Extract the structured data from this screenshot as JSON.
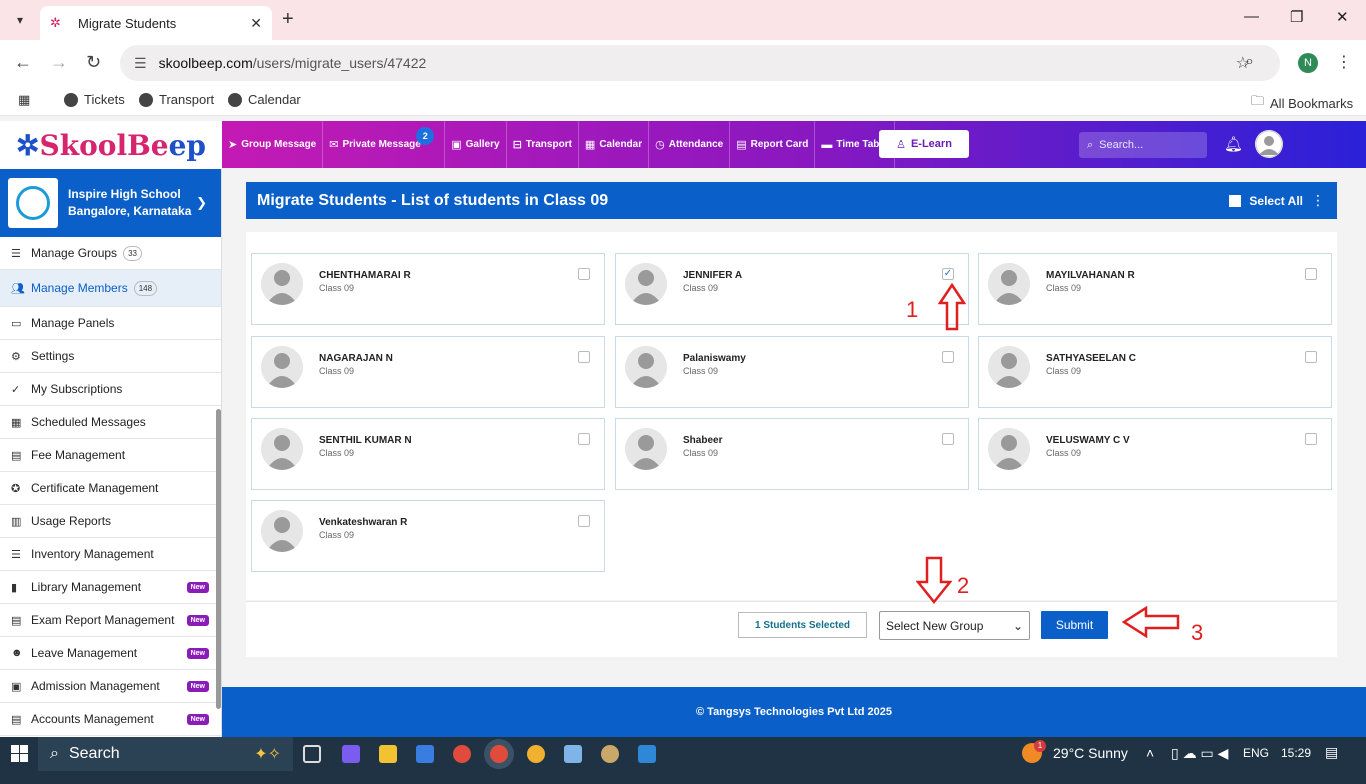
{
  "browser": {
    "tab_title": "Migrate Students",
    "url_host": "skoolbeep.com",
    "url_path": "/users/migrate_users/47422",
    "bookmarks": [
      "Tickets",
      "Transport",
      "Calendar"
    ],
    "all_bookmarks": "All Bookmarks",
    "profile_initial": "N"
  },
  "app": {
    "logo_a": "SkoolBe",
    "logo_b": "ep",
    "nav": [
      {
        "label": "Group Message",
        "icon": "send-icon"
      },
      {
        "label": "Private Message",
        "icon": "mail-icon",
        "badge": "2"
      },
      {
        "label": "Gallery",
        "icon": "image-icon"
      },
      {
        "label": "Transport",
        "icon": "bus-icon"
      },
      {
        "label": "Calendar",
        "icon": "calendar-icon"
      },
      {
        "label": "Attendance",
        "icon": "clock-icon"
      },
      {
        "label": "Report Card",
        "icon": "document-icon"
      },
      {
        "label": "Time Table",
        "icon": "timetable-icon"
      }
    ],
    "elearn": "E-Learn",
    "search_placeholder": "Search..."
  },
  "sidebar": {
    "school_name": "Inspire High School",
    "school_location": "Bangalore, Karnataka",
    "items": [
      {
        "label": "Manage Groups",
        "count": "33",
        "new": ""
      },
      {
        "label": "Manage Members",
        "count": "148",
        "new": ""
      },
      {
        "label": "Manage Panels",
        "count": "",
        "new": ""
      },
      {
        "label": "Settings",
        "count": "",
        "new": ""
      },
      {
        "label": "My Subscriptions",
        "count": "",
        "new": ""
      },
      {
        "label": "Scheduled Messages",
        "count": "",
        "new": ""
      },
      {
        "label": "Fee Management",
        "count": "",
        "new": ""
      },
      {
        "label": "Certificate Management",
        "count": "",
        "new": ""
      },
      {
        "label": "Usage Reports",
        "count": "",
        "new": ""
      },
      {
        "label": "Inventory Management",
        "count": "",
        "new": ""
      },
      {
        "label": "Library Management",
        "count": "",
        "new": "New"
      },
      {
        "label": "Exam Report Management",
        "count": "",
        "new": "New"
      },
      {
        "label": "Leave Management",
        "count": "",
        "new": "New"
      },
      {
        "label": "Admission Management",
        "count": "",
        "new": "New"
      },
      {
        "label": "Accounts Management",
        "count": "",
        "new": "New"
      }
    ]
  },
  "main": {
    "title": "Migrate Students - List of students in Class 09",
    "select_all": "Select All",
    "students": [
      {
        "name": "CHENTHAMARAI R",
        "class": "Class 09",
        "checked": false
      },
      {
        "name": "JENNIFER A",
        "class": "Class 09",
        "checked": true
      },
      {
        "name": "MAYILVAHANAN R",
        "class": "Class 09",
        "checked": false
      },
      {
        "name": "NAGARAJAN N",
        "class": "Class 09",
        "checked": false
      },
      {
        "name": "Palaniswamy",
        "class": "Class 09",
        "checked": false
      },
      {
        "name": "SATHYASEELAN C",
        "class": "Class 09",
        "checked": false
      },
      {
        "name": "SENTHIL KUMAR N",
        "class": "Class 09",
        "checked": false
      },
      {
        "name": "Shabeer",
        "class": "Class 09",
        "checked": false
      },
      {
        "name": "VELUSWAMY C V",
        "class": "Class 09",
        "checked": false
      },
      {
        "name": "Venkateshwaran R",
        "class": "Class 09",
        "checked": false
      }
    ],
    "selected_count_label": "1 Students Selected",
    "group_select_value": "Select New Group",
    "submit_label": "Submit",
    "annotations": [
      "1",
      "2",
      "3"
    ]
  },
  "footer": {
    "text": "© Tangsys Technologies Pvt Ltd 2025"
  },
  "taskbar": {
    "search": "Search",
    "weather": "29°C  Sunny",
    "weather_badge": "1",
    "lang": "ENG",
    "time": "15:29"
  }
}
